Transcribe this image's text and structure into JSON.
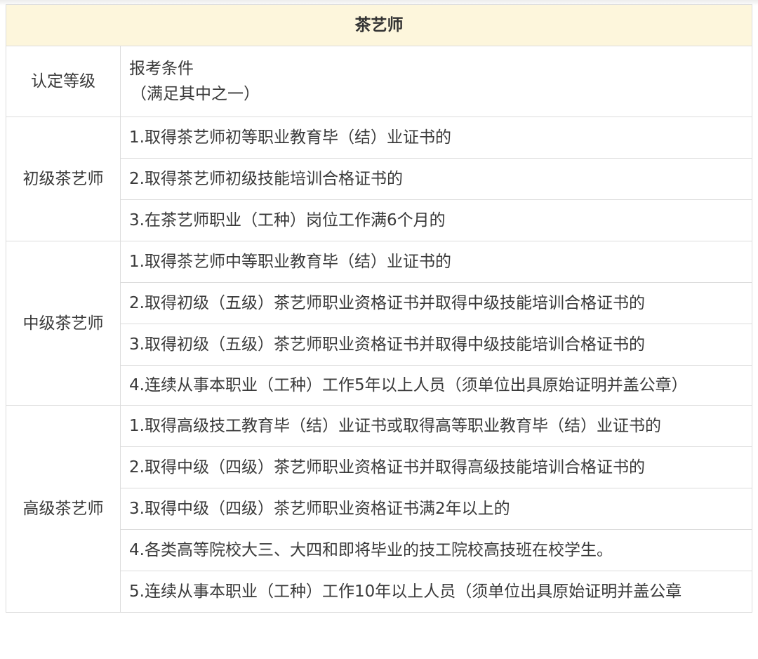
{
  "table": {
    "title": "茶艺师",
    "header": {
      "level": "认定等级",
      "condition": "报考条件",
      "condition_note": "（满足其中之一）"
    },
    "groups": [
      {
        "level": "初级茶艺师",
        "items": [
          "1.取得茶艺师初等职业教育毕（结）业证书的",
          "2.取得茶艺师初级技能培训合格证书的",
          "3.在茶艺师职业（工种）岗位工作满6个月的"
        ]
      },
      {
        "level": "中级茶艺师",
        "items": [
          "1.取得茶艺师中等职业教育毕（结）业证书的",
          "2.取得初级（五级）茶艺师职业资格证书并取得中级技能培训合格证书的",
          "3.取得初级（五级）茶艺师职业资格证书并取得中级技能培训合格证书的",
          "4.连续从事本职业（工种）工作5年以上人员（须单位出具原始证明并盖公章）"
        ]
      },
      {
        "level": "高级茶艺师",
        "items": [
          "1.取得高级技工教育毕（结）业证书或取得高等职业教育毕（结）业证书的",
          "2.取得中级（四级）茶艺师职业资格证书并取得高级技能培训合格证书的",
          "3.取得中级（四级）茶艺师职业资格证书满2年以上的",
          "4.各类高等院校大三、大四和即将毕业的技工院校高技班在校学生。",
          "5.连续从事本职业（工种）工作10年以上人员（须单位出具原始证明并盖公章"
        ]
      }
    ]
  }
}
